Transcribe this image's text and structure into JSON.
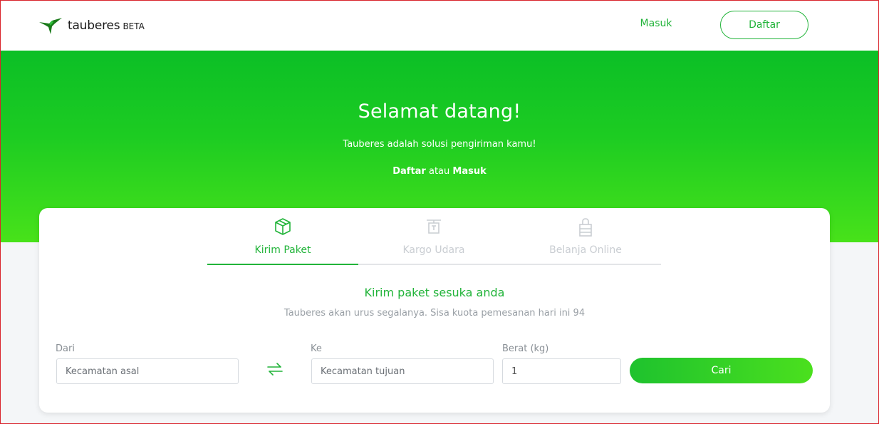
{
  "navbar": {
    "logo_text": "tauberes",
    "logo_badge": "BETA",
    "login_label": "Masuk",
    "register_label": "Daftar"
  },
  "hero": {
    "title": "Selamat datang!",
    "subtitle": "Tauberes adalah solusi pengiriman kamu!",
    "register_link": "Daftar",
    "connector": "atau",
    "login_link": "Masuk"
  },
  "tabs": [
    {
      "label": "Kirim Paket",
      "icon": "package-icon",
      "active": true
    },
    {
      "label": "Kargo Udara",
      "icon": "cargo-plane-icon",
      "active": false
    },
    {
      "label": "Belanja Online",
      "icon": "shopping-bag-icon",
      "active": false
    }
  ],
  "form": {
    "title": "Kirim paket sesuka anda",
    "subtitle": "Tauberes akan urus segalanya. Sisa kuota pemesanan hari ini 94",
    "from_label": "Dari",
    "from_placeholder": "Kecamatan asal",
    "to_label": "Ke",
    "to_placeholder": "Kecamatan tujuan",
    "weight_label": "Berat (kg)",
    "weight_value": "1",
    "search_label": "Cari"
  },
  "colors": {
    "brand_green": "#22b43a",
    "hero_top": "#0bbf26",
    "hero_bottom": "#48e21a"
  }
}
